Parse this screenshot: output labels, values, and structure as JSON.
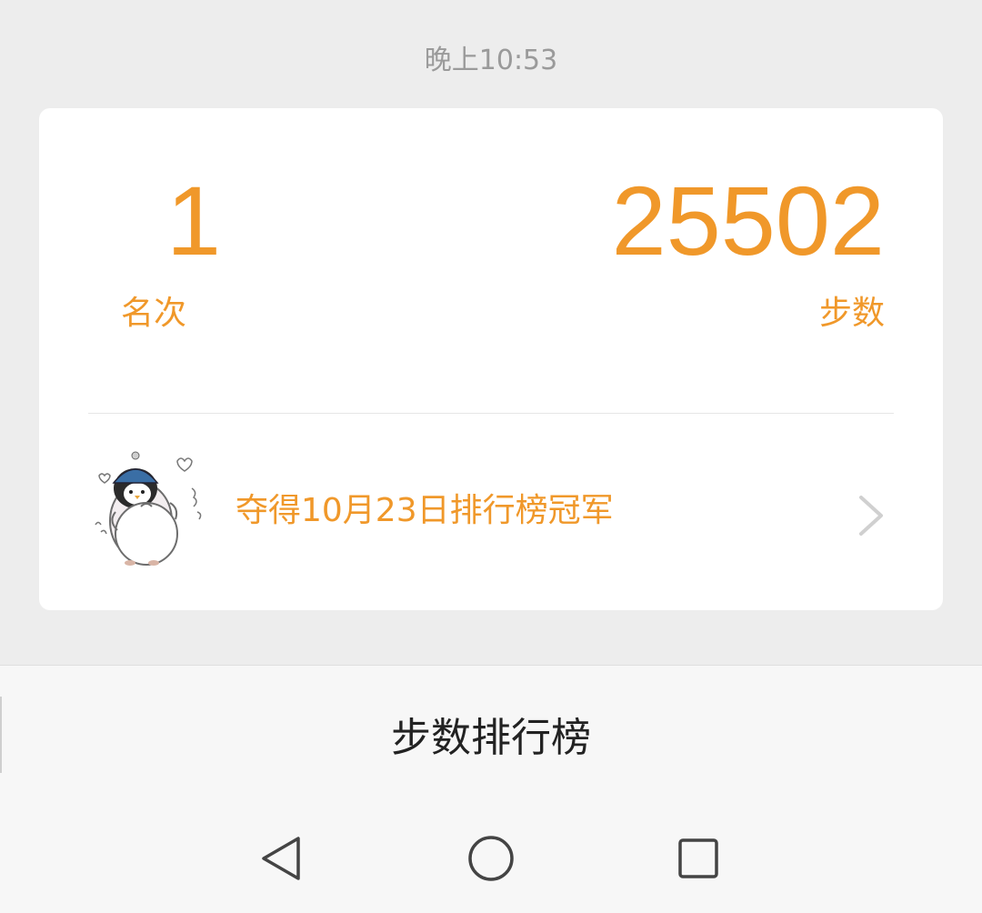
{
  "timestamp": "晚上10:53",
  "card": {
    "rank_value": "1",
    "rank_label": "名次",
    "steps_value": "25502",
    "steps_label": "步数",
    "champion_text": "夺得10月23日排行榜冠军"
  },
  "header": {
    "title": "步数排行榜"
  },
  "colors": {
    "accent": "#f0982a",
    "background": "#ededed",
    "card": "#ffffff"
  },
  "icons": {
    "champion_avatar": "penguin-sticker-icon",
    "row_arrow": "chevron-right-icon",
    "nav_back": "back-triangle-icon",
    "nav_home": "home-circle-icon",
    "nav_recents": "recents-square-icon"
  }
}
